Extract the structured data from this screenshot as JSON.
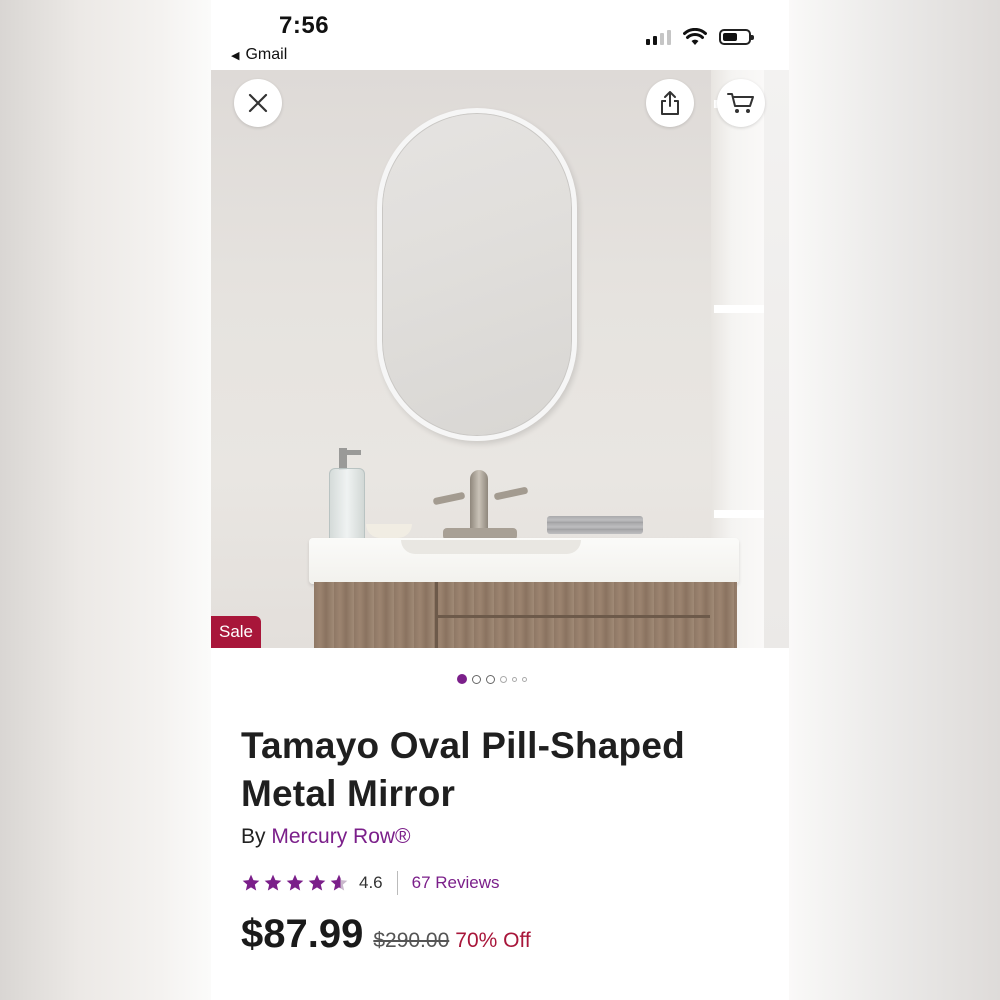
{
  "status_bar": {
    "time": "7:56",
    "back_app": "Gmail",
    "back_icon": "back-triangle-icon",
    "signal_icon": "cellular-signal-icon",
    "wifi_icon": "wifi-icon",
    "battery_icon": "battery-icon",
    "battery_level": 0.6
  },
  "gallery": {
    "close_icon": "close-icon",
    "share_icon": "share-icon",
    "cart_icon": "cart-icon",
    "sale_badge": "Sale",
    "dot_count": 6,
    "active_dot": 0
  },
  "product": {
    "title": "Tamayo Oval Pill-Shaped Metal Mirror",
    "brand_prefix": "By",
    "brand": "Mercury Row®",
    "rating": "4.6",
    "rating_value": 4.6,
    "reviews": "67 Reviews",
    "price": "$87.99",
    "original_price": "$290.00",
    "discount": "70% Off"
  },
  "colors": {
    "accent_purple": "#7b1f8a",
    "sale_red": "#a8163a",
    "text_dark": "#1f1f1f"
  }
}
